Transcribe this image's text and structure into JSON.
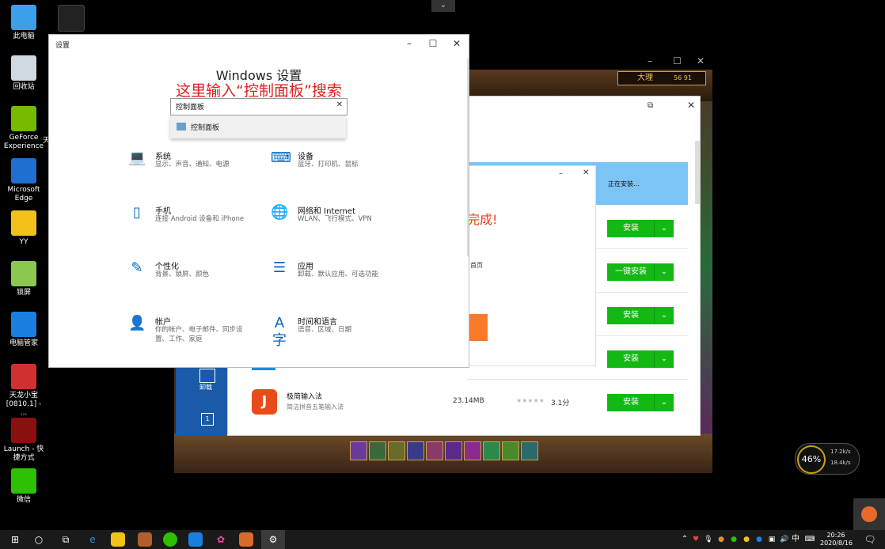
{
  "desktop": {
    "icons": [
      {
        "label": "此电脑",
        "icon": "computer-icon",
        "color": "#3aa0e8"
      },
      {
        "label": "回收站",
        "icon": "recycle-bin-icon",
        "color": "#d0d8e0"
      },
      {
        "label": "GeForce Experience",
        "icon": "nvidia-icon",
        "color": "#76b900"
      },
      {
        "label": "Microsoft Edge",
        "icon": "edge-icon",
        "color": "#1e6fd0"
      },
      {
        "label": "YY",
        "icon": "yy-icon",
        "color": "#f2c21a"
      },
      {
        "label": "锁屏",
        "icon": "image-icon",
        "color": "#8cc850"
      },
      {
        "label": "电脑管家",
        "icon": "pc-manager-icon",
        "color": "#1a7fe0"
      },
      {
        "label": "天龙小宝 [0810.1] - ...",
        "icon": "heart-app-icon",
        "color": "#d03030"
      },
      {
        "label": "Launch - 快捷方式",
        "icon": "launch-icon",
        "color": "#8a1010"
      },
      {
        "label": "微信",
        "icon": "wechat-icon",
        "color": "#2dc100"
      }
    ],
    "extra_label": "天"
  },
  "settings_window": {
    "window_title": "设置",
    "heading": "Windows 设置",
    "annotation": "这里输入“控制面板”搜索",
    "search_value": "控制面板",
    "suggestion": "控制面板",
    "items": [
      {
        "title": "系统",
        "subtitle": "显示、声音、通知、电源",
        "icon": "laptop-icon"
      },
      {
        "title": "设备",
        "subtitle": "蓝牙、打印机、鼠标",
        "icon": "devices-icon"
      },
      {
        "title": "手机",
        "subtitle": "连接 Android 设备和 iPhone",
        "icon": "phone-icon"
      },
      {
        "title": "网络和 Internet",
        "subtitle": "WLAN、飞行模式、VPN",
        "icon": "globe-icon"
      },
      {
        "title": "个性化",
        "subtitle": "背景、锁屏、颜色",
        "icon": "personalize-icon"
      },
      {
        "title": "应用",
        "subtitle": "卸载、默认应用、可选功能",
        "icon": "apps-icon"
      },
      {
        "title": "帐户",
        "subtitle": "你的帐户、电子邮件、同步设置、工作、家庭",
        "icon": "account-icon"
      },
      {
        "title": "时间和语言",
        "subtitle": "语音、区域、日期",
        "icon": "time-language-icon"
      }
    ]
  },
  "game_window": {
    "location": "大理",
    "coords": "56   91"
  },
  "installer": {
    "status": "正在安装...",
    "popup_text": "完成!",
    "popup_sub": "首页",
    "side_label": "卸载",
    "side_num": "1",
    "buttons": [
      "安装",
      "一键安装",
      "安装",
      "安装",
      "安装"
    ],
    "app": {
      "name": "极简输入法",
      "desc": "简洁拼音五笔输入法",
      "size": "23.14MB",
      "rating": "3.1分"
    }
  },
  "network_widget": {
    "percent": "46%",
    "up": "17.2k/s",
    "down": "18.4k/s"
  },
  "taskbar": {
    "ime": "中",
    "time": "20:26",
    "date": "2020/8/16"
  }
}
